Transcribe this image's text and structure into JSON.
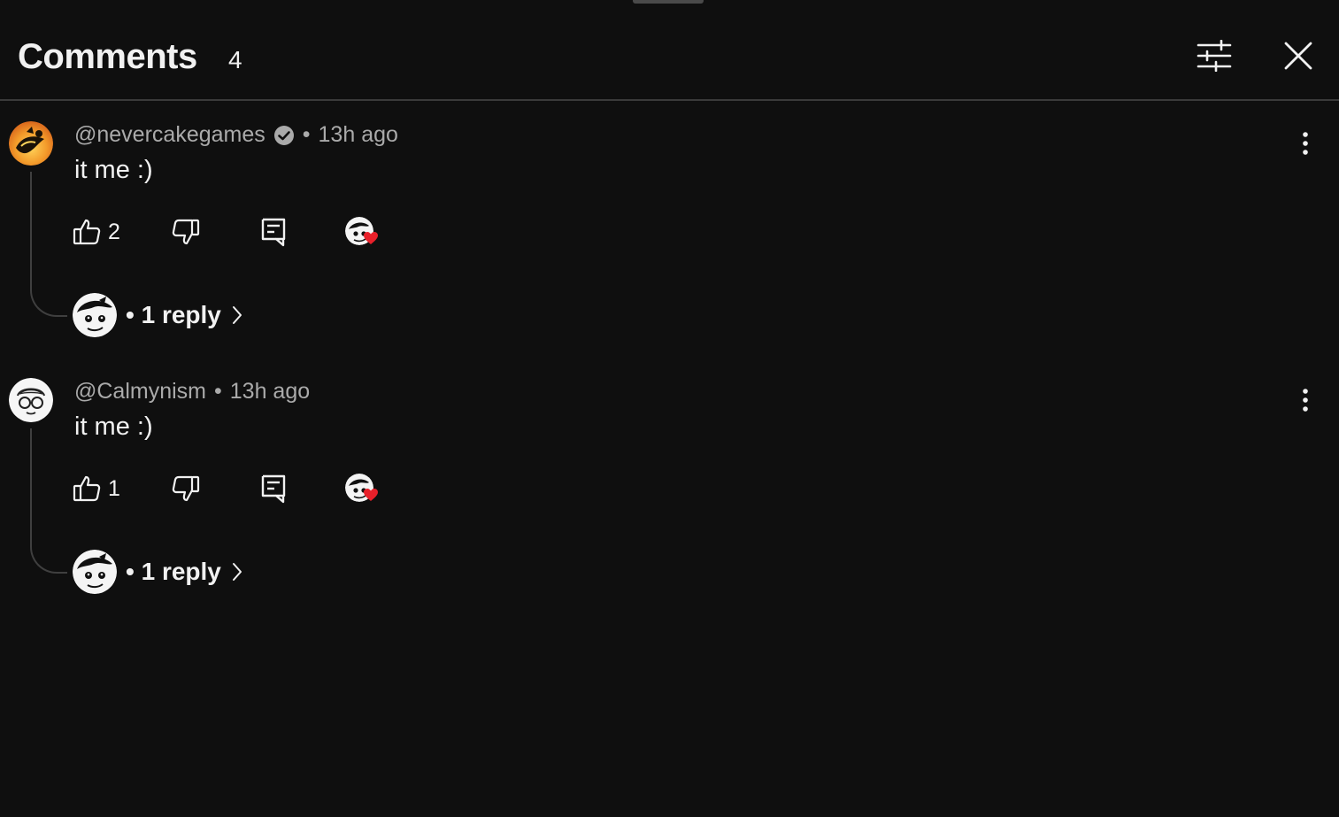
{
  "header": {
    "title": "Comments",
    "count": "4",
    "filter_icon": "sliders-icon",
    "close_icon": "close-icon"
  },
  "comments": [
    {
      "author": "@nevercakegames",
      "verified": true,
      "time": "13h ago",
      "text": "it me :)",
      "likes": "2",
      "hearted": true,
      "replies_label": "1 reply",
      "avatar_style": "orange"
    },
    {
      "author": "@Calmynism",
      "verified": false,
      "time": "13h ago",
      "text": "it me :)",
      "likes": "1",
      "hearted": true,
      "replies_label": "1 reply",
      "avatar_style": "white"
    }
  ],
  "separator": "•",
  "colors": {
    "background": "#0f0f0f",
    "text": "#f1f1f1",
    "secondary_text": "#aaaaaa",
    "divider": "#3a3a3a",
    "heart": "#e8202a"
  }
}
